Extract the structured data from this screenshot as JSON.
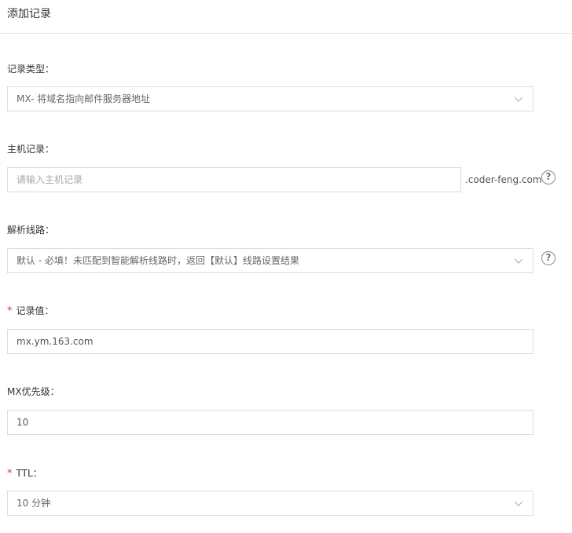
{
  "title": "添加记录",
  "fields": {
    "record_type": {
      "label": "记录类型：",
      "value": "MX- 将域名指向邮件服务器地址"
    },
    "host": {
      "label": "主机记录：",
      "placeholder": "请输入主机记录",
      "suffix": ".coder-feng.com",
      "help": "?"
    },
    "line": {
      "label": "解析线路：",
      "value": "默认 - 必填！未匹配到智能解析线路时，返回【默认】线路设置结果",
      "help": "?"
    },
    "record_value": {
      "required": "*",
      "label": "记录值：",
      "value": "mx.ym.163.com"
    },
    "mx_priority": {
      "label": "MX优先级：",
      "value": "10"
    },
    "ttl": {
      "required": "*",
      "label": "TTL：",
      "value": "10 分钟"
    }
  },
  "icons": {
    "chevron": "chevron-down-icon",
    "help": "question-circle-icon"
  }
}
